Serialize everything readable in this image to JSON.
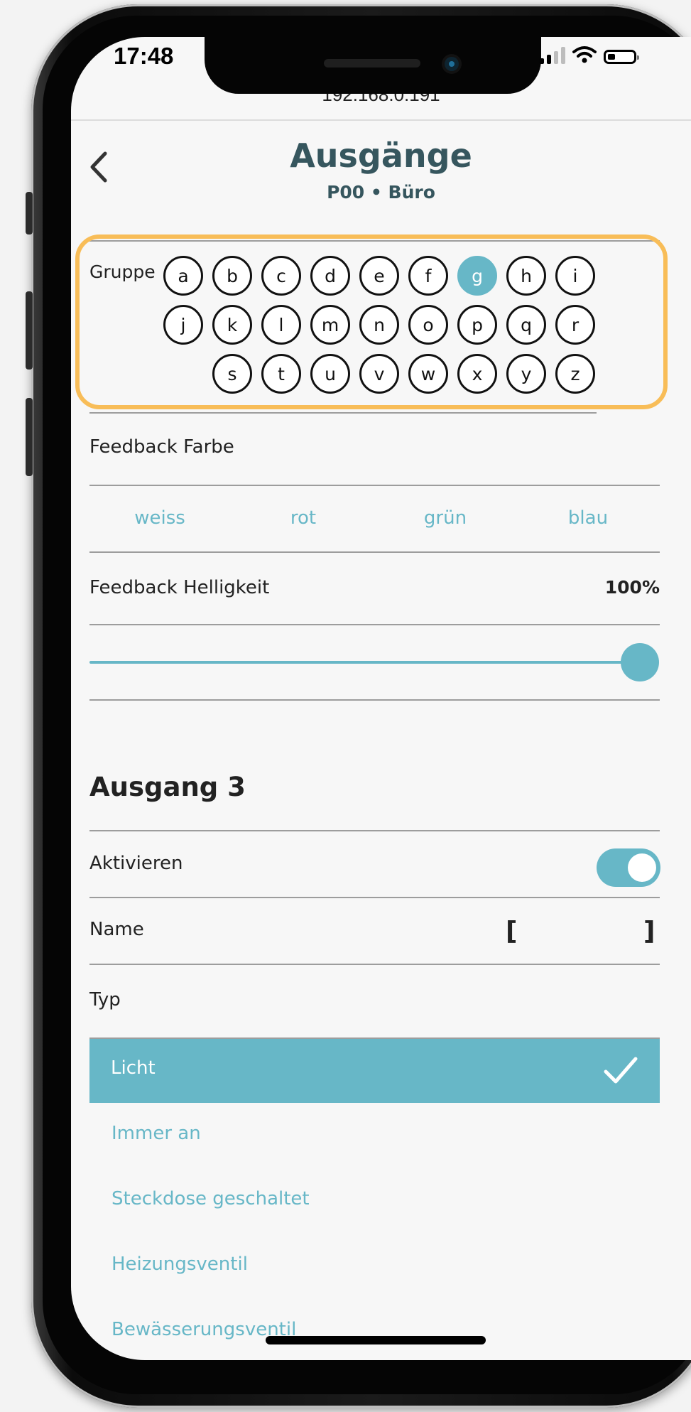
{
  "status_bar": {
    "time": "17:48"
  },
  "browser": {
    "url": "192.168.0.191"
  },
  "header": {
    "title": "Ausgänge",
    "subtitle": "P00 • Büro"
  },
  "group": {
    "label": "Gruppe",
    "letters": [
      "a",
      "b",
      "c",
      "d",
      "e",
      "f",
      "g",
      "h",
      "i",
      "j",
      "k",
      "l",
      "m",
      "n",
      "o",
      "p",
      "q",
      "r",
      "s",
      "t",
      "u",
      "v",
      "w",
      "x",
      "y",
      "z"
    ],
    "selected": "g"
  },
  "feedback_color": {
    "label": "Feedback Farbe",
    "options": [
      "weiss",
      "rot",
      "grün",
      "blau"
    ]
  },
  "feedback_brightness": {
    "label": "Feedback Helligkeit",
    "value_text": "100%",
    "value": 1.0
  },
  "output": {
    "title": "Ausgang 3",
    "activate_label": "Aktivieren",
    "activated": true,
    "name_label": "Name",
    "name_open": "[",
    "name_close": "]",
    "type_label": "Typ",
    "types": [
      "Licht",
      "Immer an",
      "Steckdose geschaltet",
      "Heizungsventil",
      "Bewässerungsventil"
    ],
    "selected_type": "Licht"
  },
  "colors": {
    "accent": "#67b7c7",
    "title": "#36565e",
    "highlight": "#f8bd58"
  }
}
